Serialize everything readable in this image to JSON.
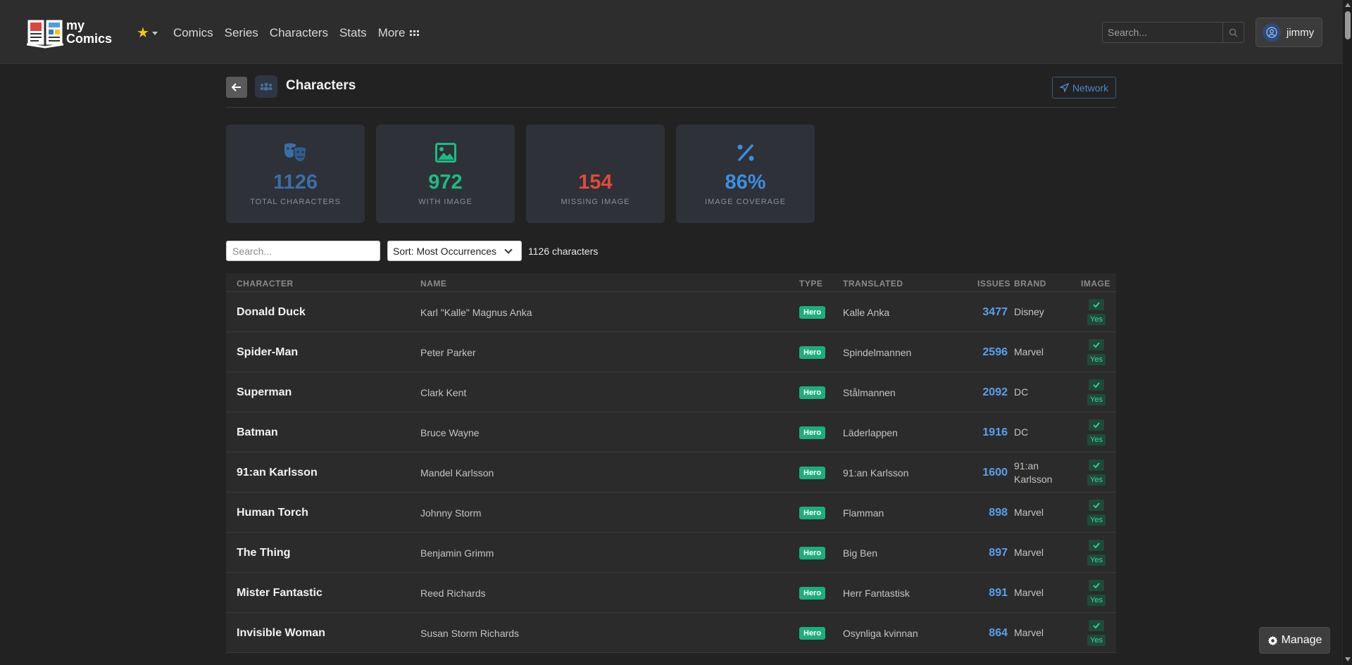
{
  "app": {
    "logo_line1": "my",
    "logo_line2": "Comics"
  },
  "nav": {
    "links": [
      "Comics",
      "Series",
      "Characters",
      "Stats",
      "More"
    ],
    "search_placeholder": "Search...",
    "user": "jimmy"
  },
  "page": {
    "title": "Characters",
    "network_label": "Network"
  },
  "stats": [
    {
      "value": "1126",
      "label": "TOTAL CHARACTERS",
      "color": "#3a6ea8",
      "icon": "theater-masks-icon"
    },
    {
      "value": "972",
      "label": "WITH IMAGE",
      "color": "#1dbb83",
      "icon": "image-icon"
    },
    {
      "value": "154",
      "label": "MISSING IMAGE",
      "color": "#e2493b",
      "icon": ""
    },
    {
      "value": "86%",
      "label": "IMAGE COVERAGE",
      "color": "#3a8fe0",
      "icon": "percent-icon"
    }
  ],
  "controls": {
    "search_placeholder": "Search...",
    "sort_value": "Sort: Most Occurrences",
    "count_text": "1126 characters"
  },
  "table": {
    "headers": [
      "CHARACTER",
      "NAME",
      "TYPE",
      "TRANSLATED",
      "ISSUES",
      "BRAND",
      "IMAGE"
    ],
    "rows": [
      {
        "character": "Donald Duck",
        "name": "Karl \"Kalle\" Magnus Anka",
        "type": "Hero",
        "translated": "Kalle Anka",
        "issues": "3477",
        "brand": "Disney",
        "image": "Yes"
      },
      {
        "character": "Spider-Man",
        "name": "Peter Parker",
        "type": "Hero",
        "translated": "Spindelmannen",
        "issues": "2596",
        "brand": "Marvel",
        "image": "Yes"
      },
      {
        "character": "Superman",
        "name": "Clark Kent",
        "type": "Hero",
        "translated": "Stålmannen",
        "issues": "2092",
        "brand": "DC",
        "image": "Yes"
      },
      {
        "character": "Batman",
        "name": "Bruce Wayne",
        "type": "Hero",
        "translated": "Läderlappen",
        "issues": "1916",
        "brand": "DC",
        "image": "Yes"
      },
      {
        "character": "91:an Karlsson",
        "name": "Mandel Karlsson",
        "type": "Hero",
        "translated": "91:an Karlsson",
        "issues": "1600",
        "brand": "91:an Karlsson",
        "image": "Yes"
      },
      {
        "character": "Human Torch",
        "name": "Johnny Storm",
        "type": "Hero",
        "translated": "Flamman",
        "issues": "898",
        "brand": "Marvel",
        "image": "Yes"
      },
      {
        "character": "The Thing",
        "name": "Benjamin Grimm",
        "type": "Hero",
        "translated": "Big Ben",
        "issues": "897",
        "brand": "Marvel",
        "image": "Yes"
      },
      {
        "character": "Mister Fantastic",
        "name": "Reed Richards",
        "type": "Hero",
        "translated": "Herr Fantastisk",
        "issues": "891",
        "brand": "Marvel",
        "image": "Yes"
      },
      {
        "character": "Invisible Woman",
        "name": "Susan Storm Richards",
        "type": "Hero",
        "translated": "Osynliga kvinnan",
        "issues": "864",
        "brand": "Marvel",
        "image": "Yes"
      }
    ]
  },
  "manage_label": "Manage"
}
